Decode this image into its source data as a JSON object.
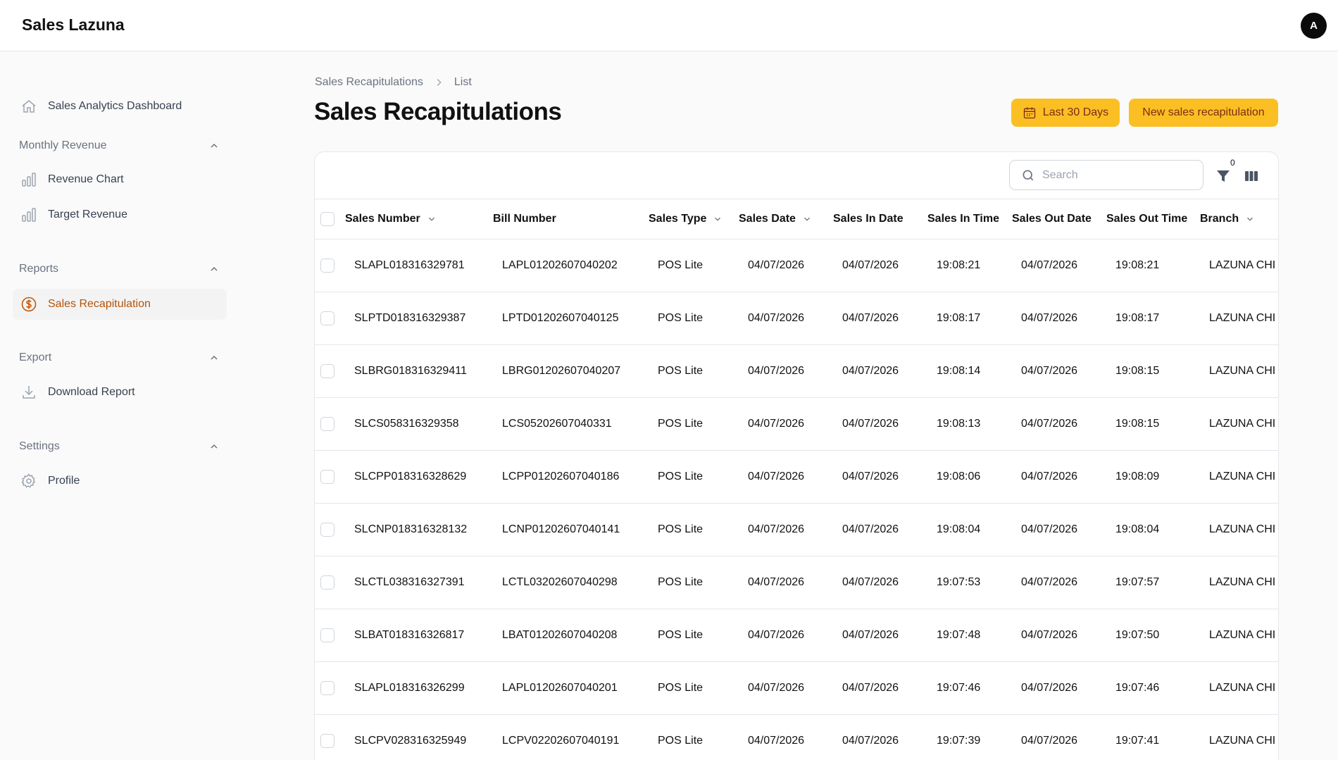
{
  "app": {
    "title": "Sales Lazuna",
    "avatar_initial": "A"
  },
  "sidebar": {
    "dashboard": {
      "label": "Sales Analytics Dashboard",
      "icon": "home-icon"
    },
    "groups": [
      {
        "title": "Monthly Revenue",
        "items": [
          {
            "label": "Revenue Chart",
            "icon": "bar-chart-icon"
          },
          {
            "label": "Target Revenue",
            "icon": "bar-chart-icon"
          }
        ]
      },
      {
        "title": "Reports",
        "items": [
          {
            "label": "Sales Recapitulation",
            "icon": "dollar-circle-icon",
            "active": true
          }
        ]
      },
      {
        "title": "Export",
        "items": [
          {
            "label": "Download Report",
            "icon": "download-icon"
          }
        ]
      },
      {
        "title": "Settings",
        "items": [
          {
            "label": "Profile",
            "icon": "gear-icon"
          }
        ]
      }
    ]
  },
  "breadcrumb": {
    "parent": "Sales Recapitulations",
    "current": "List"
  },
  "page": {
    "title": "Sales Recapitulations"
  },
  "actions": {
    "range_label": "Last 30 Days",
    "new_label": "New sales recapitulation"
  },
  "colors": {
    "accent": "#fbbf24",
    "accent_text": "#7c2d12",
    "active_nav_text": "#b45309"
  },
  "toolbar": {
    "search_placeholder": "Search",
    "filter_count": "0"
  },
  "table": {
    "columns": [
      "Sales Number",
      "Bill Number",
      "Sales Type",
      "Sales Date",
      "Sales In Date",
      "Sales In Time",
      "Sales Out Date",
      "Sales Out Time",
      "Branch"
    ],
    "sortable": [
      true,
      false,
      true,
      true,
      false,
      false,
      false,
      false,
      true
    ],
    "rows": [
      [
        "SLAPL018316329781",
        "LAPL01202607040202",
        "POS Lite",
        "04/07/2026",
        "04/07/2026",
        "19:08:21",
        "04/07/2026",
        "19:08:21",
        "LAZUNA CHI"
      ],
      [
        "SLPTD018316329387",
        "LPTD01202607040125",
        "POS Lite",
        "04/07/2026",
        "04/07/2026",
        "19:08:17",
        "04/07/2026",
        "19:08:17",
        "LAZUNA CHI"
      ],
      [
        "SLBRG018316329411",
        "LBRG01202607040207",
        "POS Lite",
        "04/07/2026",
        "04/07/2026",
        "19:08:14",
        "04/07/2026",
        "19:08:15",
        "LAZUNA CHI"
      ],
      [
        "SLCS058316329358",
        "LCS05202607040331",
        "POS Lite",
        "04/07/2026",
        "04/07/2026",
        "19:08:13",
        "04/07/2026",
        "19:08:15",
        "LAZUNA CHI"
      ],
      [
        "SLCPP018316328629",
        "LCPP01202607040186",
        "POS Lite",
        "04/07/2026",
        "04/07/2026",
        "19:08:06",
        "04/07/2026",
        "19:08:09",
        "LAZUNA CHI"
      ],
      [
        "SLCNP018316328132",
        "LCNP01202607040141",
        "POS Lite",
        "04/07/2026",
        "04/07/2026",
        "19:08:04",
        "04/07/2026",
        "19:08:04",
        "LAZUNA CHI"
      ],
      [
        "SLCTL038316327391",
        "LCTL03202607040298",
        "POS Lite",
        "04/07/2026",
        "04/07/2026",
        "19:07:53",
        "04/07/2026",
        "19:07:57",
        "LAZUNA CHI"
      ],
      [
        "SLBAT018316326817",
        "LBAT01202607040208",
        "POS Lite",
        "04/07/2026",
        "04/07/2026",
        "19:07:48",
        "04/07/2026",
        "19:07:50",
        "LAZUNA CHI"
      ],
      [
        "SLAPL018316326299",
        "LAPL01202607040201",
        "POS Lite",
        "04/07/2026",
        "04/07/2026",
        "19:07:46",
        "04/07/2026",
        "19:07:46",
        "LAZUNA CHI"
      ],
      [
        "SLCPV028316325949",
        "LCPV02202607040191",
        "POS Lite",
        "04/07/2026",
        "04/07/2026",
        "19:07:39",
        "04/07/2026",
        "19:07:41",
        "LAZUNA CHI"
      ]
    ]
  }
}
